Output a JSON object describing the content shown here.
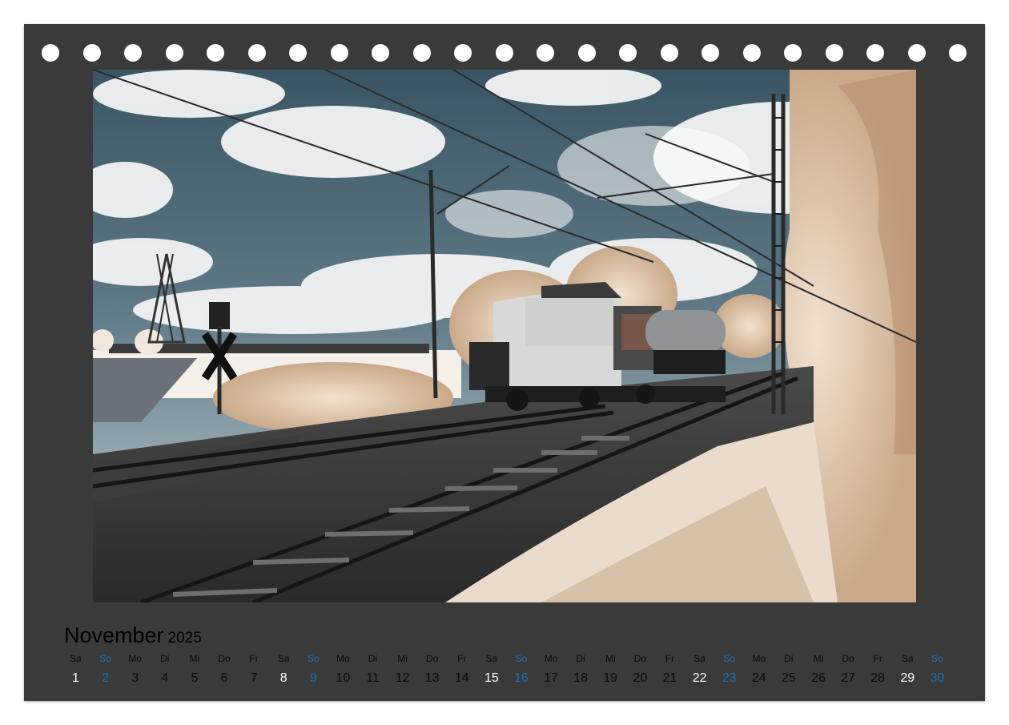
{
  "calendar": {
    "month": "November",
    "year": "2025",
    "days": [
      {
        "wd": "Sa",
        "n": "1",
        "type": "sat"
      },
      {
        "wd": "So",
        "n": "2",
        "type": "sun"
      },
      {
        "wd": "Mo",
        "n": "3",
        "type": "wk"
      },
      {
        "wd": "Di",
        "n": "4",
        "type": "wk"
      },
      {
        "wd": "Mi",
        "n": "5",
        "type": "wk"
      },
      {
        "wd": "Do",
        "n": "6",
        "type": "wk"
      },
      {
        "wd": "Fr",
        "n": "7",
        "type": "wk"
      },
      {
        "wd": "Sa",
        "n": "8",
        "type": "sat"
      },
      {
        "wd": "So",
        "n": "9",
        "type": "sun"
      },
      {
        "wd": "Mo",
        "n": "10",
        "type": "wk"
      },
      {
        "wd": "Di",
        "n": "11",
        "type": "wk"
      },
      {
        "wd": "Mi",
        "n": "12",
        "type": "wk"
      },
      {
        "wd": "Do",
        "n": "13",
        "type": "wk"
      },
      {
        "wd": "Fr",
        "n": "14",
        "type": "wk"
      },
      {
        "wd": "Sa",
        "n": "15",
        "type": "sat"
      },
      {
        "wd": "So",
        "n": "16",
        "type": "sun"
      },
      {
        "wd": "Mo",
        "n": "17",
        "type": "wk"
      },
      {
        "wd": "Di",
        "n": "18",
        "type": "wk"
      },
      {
        "wd": "Mi",
        "n": "19",
        "type": "wk"
      },
      {
        "wd": "Do",
        "n": "20",
        "type": "wk"
      },
      {
        "wd": "Fr",
        "n": "21",
        "type": "wk"
      },
      {
        "wd": "Sa",
        "n": "22",
        "type": "sat"
      },
      {
        "wd": "So",
        "n": "23",
        "type": "sun"
      },
      {
        "wd": "Mo",
        "n": "24",
        "type": "wk"
      },
      {
        "wd": "Di",
        "n": "25",
        "type": "wk"
      },
      {
        "wd": "Mi",
        "n": "26",
        "type": "wk"
      },
      {
        "wd": "Do",
        "n": "27",
        "type": "wk"
      },
      {
        "wd": "Fr",
        "n": "28",
        "type": "wk"
      },
      {
        "wd": "Sa",
        "n": "29",
        "type": "sat"
      },
      {
        "wd": "So",
        "n": "30",
        "type": "sun"
      }
    ]
  },
  "colors": {
    "page_background": "#3a3a3a",
    "sunday": "#1d6fb8",
    "saturday_number": "#ffffff",
    "text": "#0a0a0a"
  }
}
